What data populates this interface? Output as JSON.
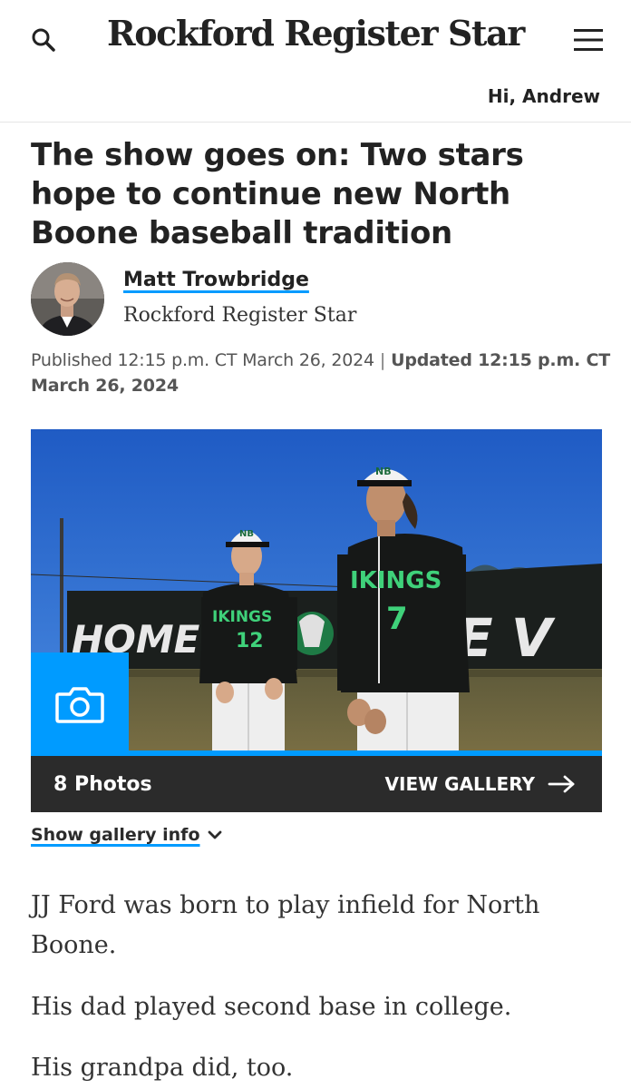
{
  "header": {
    "masthead": "Rockford Register Star",
    "greeting": "Hi, Andrew",
    "search_icon": "search-icon",
    "menu_icon": "hamburger-menu-icon"
  },
  "article": {
    "headline": "The show goes on: Two stars hope to continue new North Boone baseball tradition",
    "author": {
      "name": "Matt Trowbridge",
      "publication": "Rockford Register Star"
    },
    "published": "Published 12:15 p.m. CT March 26, 2024",
    "separator": "|",
    "updated": "Updated 12:15 p.m. CT March 26, 2024",
    "gallery": {
      "photo_count": "8 Photos",
      "view_label": "VIEW GALLERY",
      "camera_icon": "camera-icon",
      "arrow_icon": "arrow-right-icon",
      "info_label": "Show gallery info",
      "info_icon": "chevron-down-icon"
    },
    "photo": {
      "fence_text_left": "HOME O",
      "fence_text_right": "E V",
      "jersey_left_text": "IKINGS",
      "jersey_left_number": "12",
      "jersey_right_text": "IKINGS",
      "jersey_right_number": "7",
      "cap_logo": "NB"
    },
    "paragraphs": [
      "JJ Ford was born to play infield for North Boone.",
      "His dad played second base in college.",
      "His grandpa did, too."
    ]
  },
  "colors": {
    "accent": "#009bff",
    "gallery_bar": "#2b2b2b",
    "jersey_green": "#2ecc71",
    "sky": "#2f6fd0"
  }
}
